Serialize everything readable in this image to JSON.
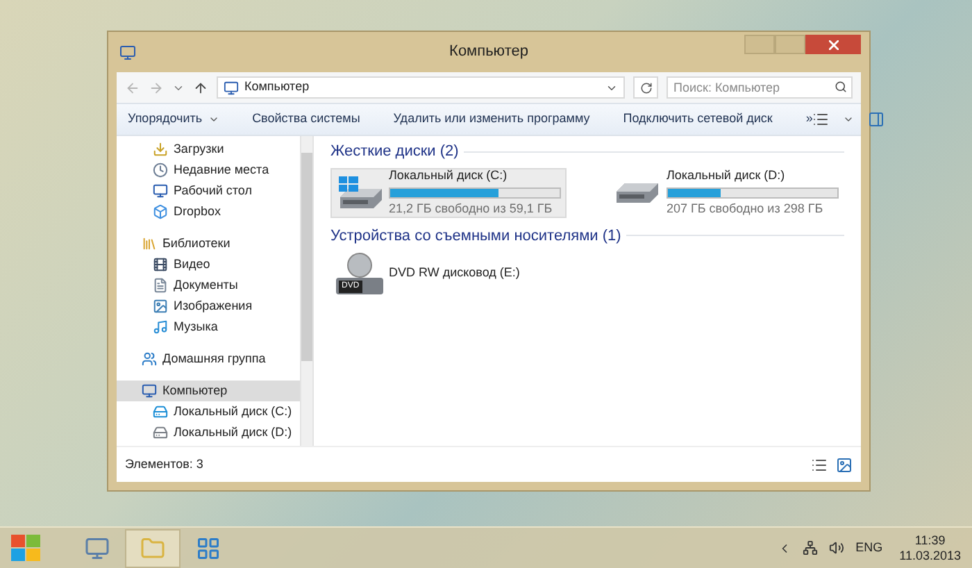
{
  "window": {
    "title": "Компьютер"
  },
  "address_bar": {
    "path": "Компьютер",
    "search": {
      "placeholder": "Поиск: Компьютер"
    }
  },
  "toolbar": {
    "items": [
      {
        "label": "Упорядочить",
        "dropdown": true
      },
      {
        "label": "Свойства системы",
        "dropdown": false
      },
      {
        "label": "Удалить или изменить программу",
        "dropdown": false
      },
      {
        "label": "Подключить сетевой диск",
        "dropdown": false
      }
    ],
    "more": "»"
  },
  "navigation": [
    {
      "children": [
        {
          "label": "Загрузки",
          "selected": false
        },
        {
          "label": "Недавние места",
          "selected": false
        },
        {
          "label": "Рабочий стол",
          "selected": false
        },
        {
          "label": "Dropbox",
          "selected": false
        }
      ]
    },
    {
      "label": "Библиотеки",
      "selected": false,
      "children": [
        {
          "label": "Видео",
          "selected": false
        },
        {
          "label": "Документы",
          "selected": false
        },
        {
          "label": "Изображения",
          "selected": false
        },
        {
          "label": "Музыка",
          "selected": false
        }
      ]
    },
    {
      "label": "Домашняя группа",
      "selected": false
    },
    {
      "label": "Компьютер",
      "selected": true,
      "children": [
        {
          "label": "Локальный диск (C:)",
          "selected": false
        },
        {
          "label": "Локальный диск (D:)",
          "selected": false
        }
      ]
    }
  ],
  "groups": [
    {
      "title": "Жесткие диски (2)",
      "items": [
        {
          "kind": "disk",
          "name": "Локальный диск (C:)",
          "system": true,
          "level": 0.64,
          "free": "21,2 ГБ свободно из 59,1 ГБ",
          "selected": true
        },
        {
          "kind": "disk",
          "name": "Локальный диск (D:)",
          "system": false,
          "level": 0.31,
          "free": "207 ГБ свободно из 298 ГБ",
          "selected": false
        }
      ]
    },
    {
      "title": "Устройства со съемными носителями (1)",
      "items": [
        {
          "kind": "optical",
          "name": "DVD RW дисковод (E:)",
          "badge": "DVD",
          "selected": false
        }
      ]
    }
  ],
  "status_bar": {
    "count": "Элементов: 3"
  },
  "taskbar": {
    "language": "ENG",
    "time": "11:39",
    "date": "11.03.2013"
  }
}
